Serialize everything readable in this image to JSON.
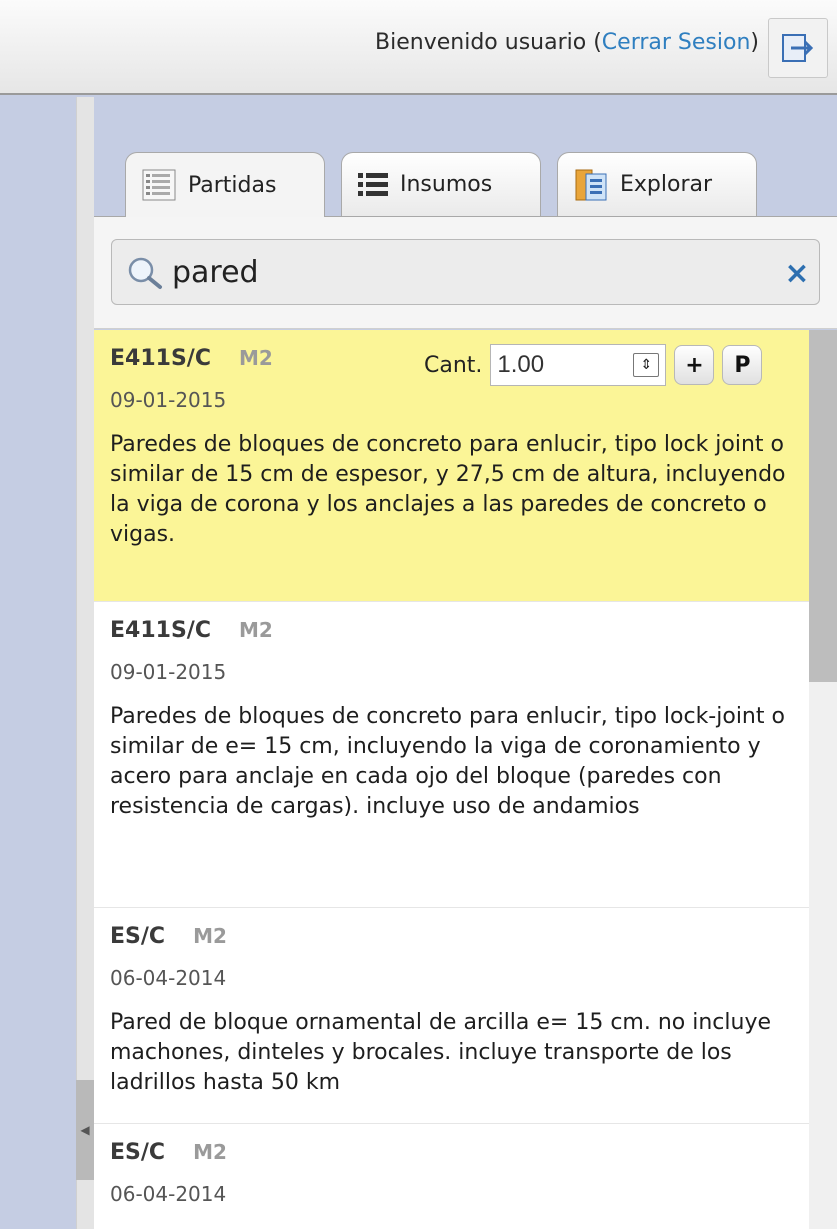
{
  "header": {
    "welcome_text": "Bienvenido usuario (",
    "logout_label": "Cerrar Sesion",
    "welcome_close": ")"
  },
  "tabs": [
    {
      "label": "Partidas",
      "icon": "document-list-icon",
      "active": true
    },
    {
      "label": "Insumos",
      "icon": "bullet-list-icon",
      "active": false
    },
    {
      "label": "Explorar",
      "icon": "explorer-icon",
      "active": false
    }
  ],
  "search": {
    "value": "pared",
    "clear_label": "×"
  },
  "selected_controls": {
    "cant_label": "Cant.",
    "cant_value": "1.00",
    "add_label": "+",
    "p_label": "P"
  },
  "items": [
    {
      "code": "E411S/C",
      "unit": "M2",
      "date": "09-01-2015",
      "description": "Paredes de bloques de concreto para enlucir, tipo lock joint o similar de 15 cm de espesor, y 27,5 cm de altura, incluyendo la viga de corona y los anclajes a las paredes de concreto o vigas."
    },
    {
      "code": "E411S/C",
      "unit": "M2",
      "date": "09-01-2015",
      "description": "Paredes de bloques de concreto para enlucir, tipo lock-joint o similar de e= 15 cm, incluyendo la viga de coronamiento y acero para anclaje en cada ojo del bloque (paredes con resistencia de cargas). incluye uso de andamios"
    },
    {
      "code": "ES/C",
      "unit": "M2",
      "date": "06-04-2014",
      "description": "Pared de bloque ornamental de arcilla e= 15 cm. no incluye machones, dinteles y brocales. incluye transporte de los ladrillos hasta 50 km"
    },
    {
      "code": "ES/C",
      "unit": "M2",
      "date": "06-04-2014",
      "description": ""
    }
  ]
}
